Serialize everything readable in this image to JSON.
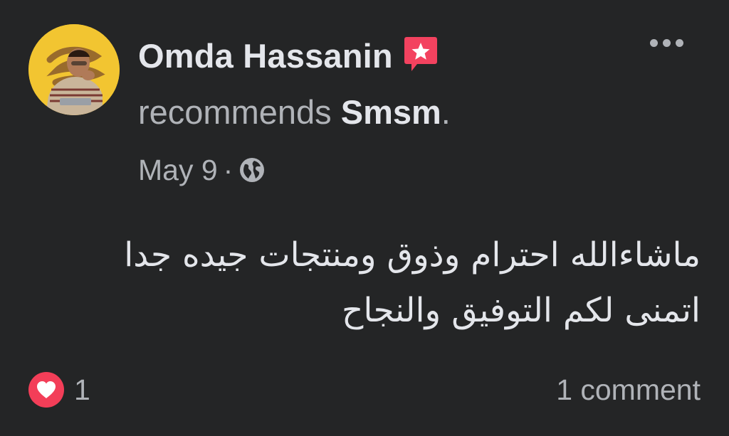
{
  "post": {
    "author": "Omda Hassanin",
    "action_text": "recommends",
    "page_name": "Smsm",
    "trailing_period": ".",
    "date": "May 9",
    "separator": "·",
    "privacy_icon": "globe-icon",
    "body_lines": [
      "ماشاءالله احترام وذوق ومنتجات جيده جدا",
      "اتمنى لكم التوفيق والنجاح"
    ],
    "reaction_count": "1",
    "reaction_icon": "heart-icon",
    "comments_label": "1 comment"
  },
  "colors": {
    "background": "#242526",
    "primary_text": "#e4e6eb",
    "secondary_text": "#b0b3b8",
    "recommend_badge": "#f3425f",
    "love_reaction": "#f33e58",
    "avatar_ring": "#f2c531"
  }
}
